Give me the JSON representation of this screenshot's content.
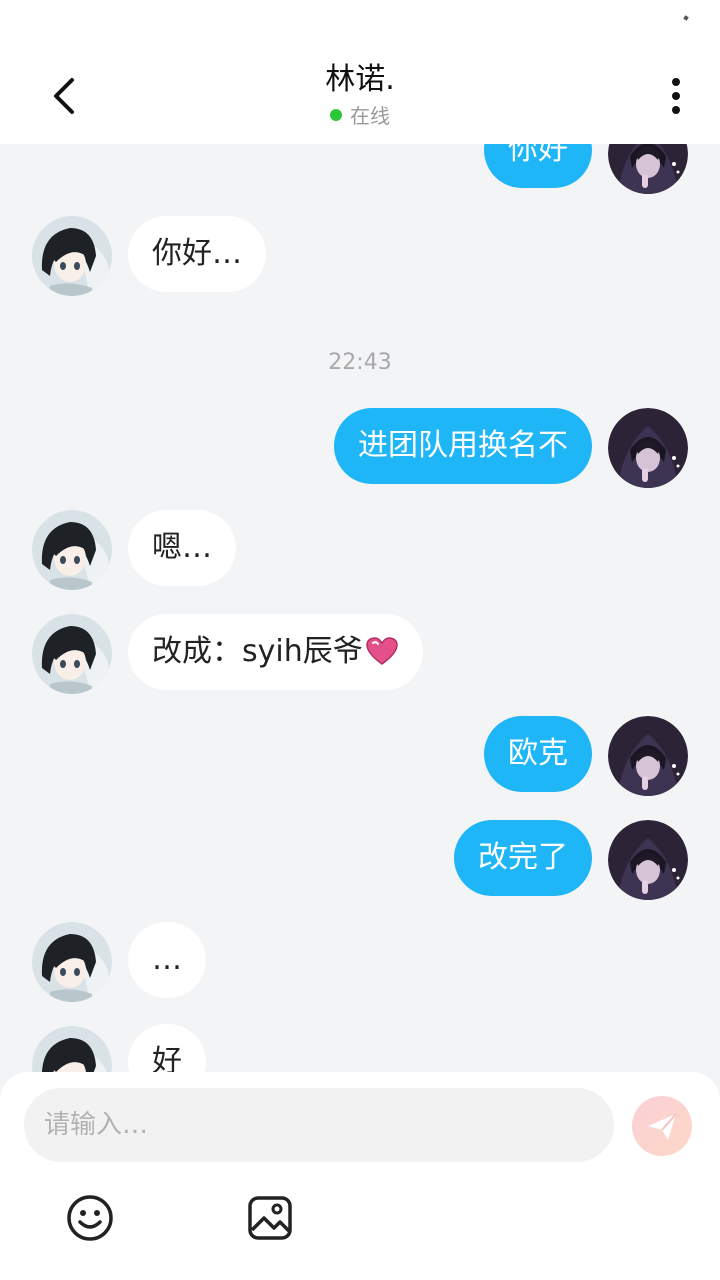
{
  "header": {
    "title": "林诺.",
    "status": "在线",
    "status_color": "#2fc73a",
    "back_icon": "chevron-left-icon",
    "more_icon": "more-vertical-icon"
  },
  "messages": [
    {
      "id": "m0",
      "side": "out",
      "text": "你好"
    },
    {
      "id": "m1",
      "side": "in",
      "text": "你好…"
    },
    {
      "id": "t1",
      "type": "timestamp",
      "text": "22:43"
    },
    {
      "id": "m2",
      "side": "out",
      "text": "进团队用换名不"
    },
    {
      "id": "m3",
      "side": "in",
      "text": "嗯…"
    },
    {
      "id": "m4",
      "side": "in",
      "text": "改成：syih辰爷",
      "emoji": "heart-emoji"
    },
    {
      "id": "m5",
      "side": "out",
      "text": "欧克"
    },
    {
      "id": "m6",
      "side": "out",
      "text": "改完了"
    },
    {
      "id": "m7",
      "side": "in",
      "text": "…"
    },
    {
      "id": "m8",
      "side": "in",
      "text": "好"
    }
  ],
  "composer": {
    "placeholder": "请输入…",
    "send_icon": "send-icon",
    "emoji_icon": "smile-icon",
    "image_icon": "image-icon"
  },
  "colors": {
    "outgoing_bubble": "#1fb6f7",
    "incoming_bubble": "#ffffff",
    "background": "#f3f4f6"
  }
}
